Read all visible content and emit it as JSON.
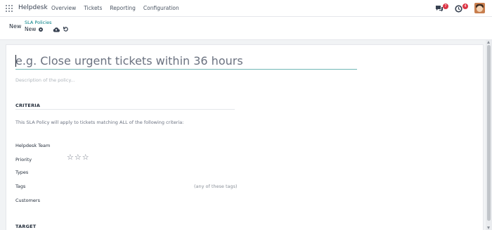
{
  "navbar": {
    "brand": "Helpdesk",
    "menu": [
      "Overview",
      "Tickets",
      "Reporting",
      "Configuration"
    ],
    "messages_count": "7",
    "activities_count": "4"
  },
  "control_panel": {
    "new_label": "New",
    "breadcrumb_parent": "SLA Policies",
    "breadcrumb_current": "New"
  },
  "form": {
    "name_placeholder": "e.g. Close urgent tickets within 36 hours",
    "description_placeholder": "Description of the policy...",
    "criteria_title": "CRITERIA",
    "criteria_text": "This SLA Policy will apply to tickets matching ALL of the following criteria:",
    "labels": {
      "team": "Helpdesk Team",
      "priority": "Priority",
      "types": "Types",
      "tags": "Tags",
      "customers": "Customers"
    },
    "priority_stars": 0,
    "tags_hint": "(any of these tags)",
    "target_title": "TARGET"
  },
  "colors": {
    "accent": "#017e84",
    "badge": "#dc3545",
    "input_underline": "#71b7b6"
  }
}
